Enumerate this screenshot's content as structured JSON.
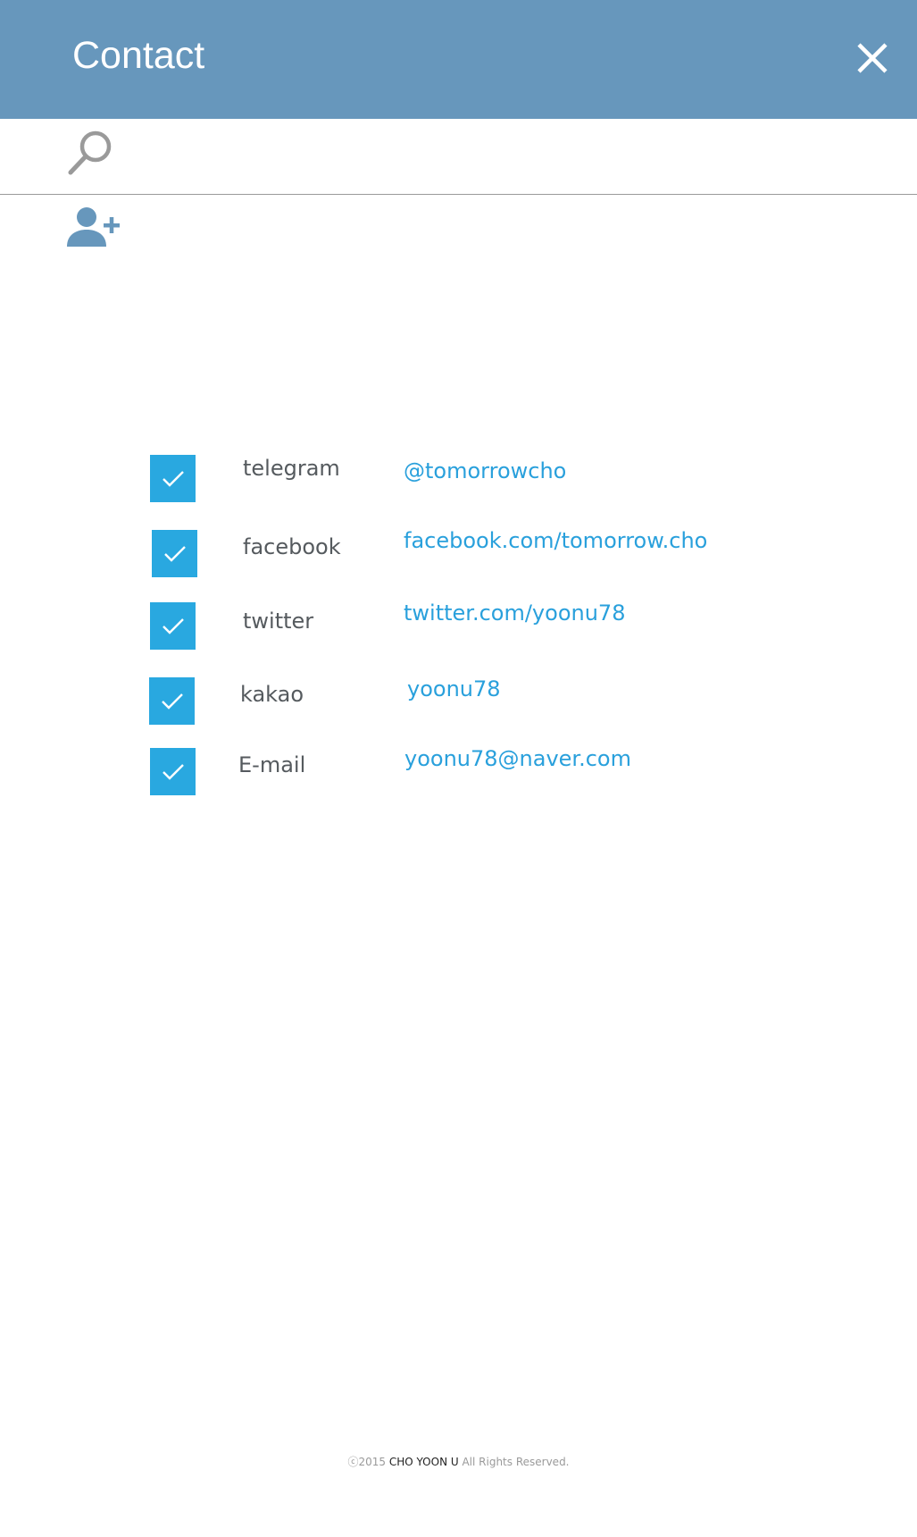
{
  "header": {
    "title": "Contact",
    "background": "#6797bc",
    "close_icon": "close-icon"
  },
  "search": {
    "icon": "search-icon",
    "placeholder": "",
    "value": ""
  },
  "add_user": {
    "icon": "add-user-icon",
    "color": "#6797bc"
  },
  "contacts": [
    {
      "label": "telegram",
      "value": "@tomorrowcho",
      "checked": true
    },
    {
      "label": "facebook",
      "value": "facebook.com/tomorrow.cho",
      "checked": true
    },
    {
      "label": "twitter",
      "value": "twitter.com/yoonu78",
      "checked": true
    },
    {
      "label": "kakao",
      "value": "yoonu78",
      "checked": true
    },
    {
      "label": "E-mail",
      "value": "yoonu78@naver.com",
      "checked": true
    }
  ],
  "colors": {
    "accent": "#29a8e0",
    "link": "#29a0dc",
    "label": "#555a5e"
  },
  "footer": {
    "prefix": "ⓒ2015 ",
    "owner": "CHO YOON U",
    "suffix": " All Rights Reserved."
  }
}
